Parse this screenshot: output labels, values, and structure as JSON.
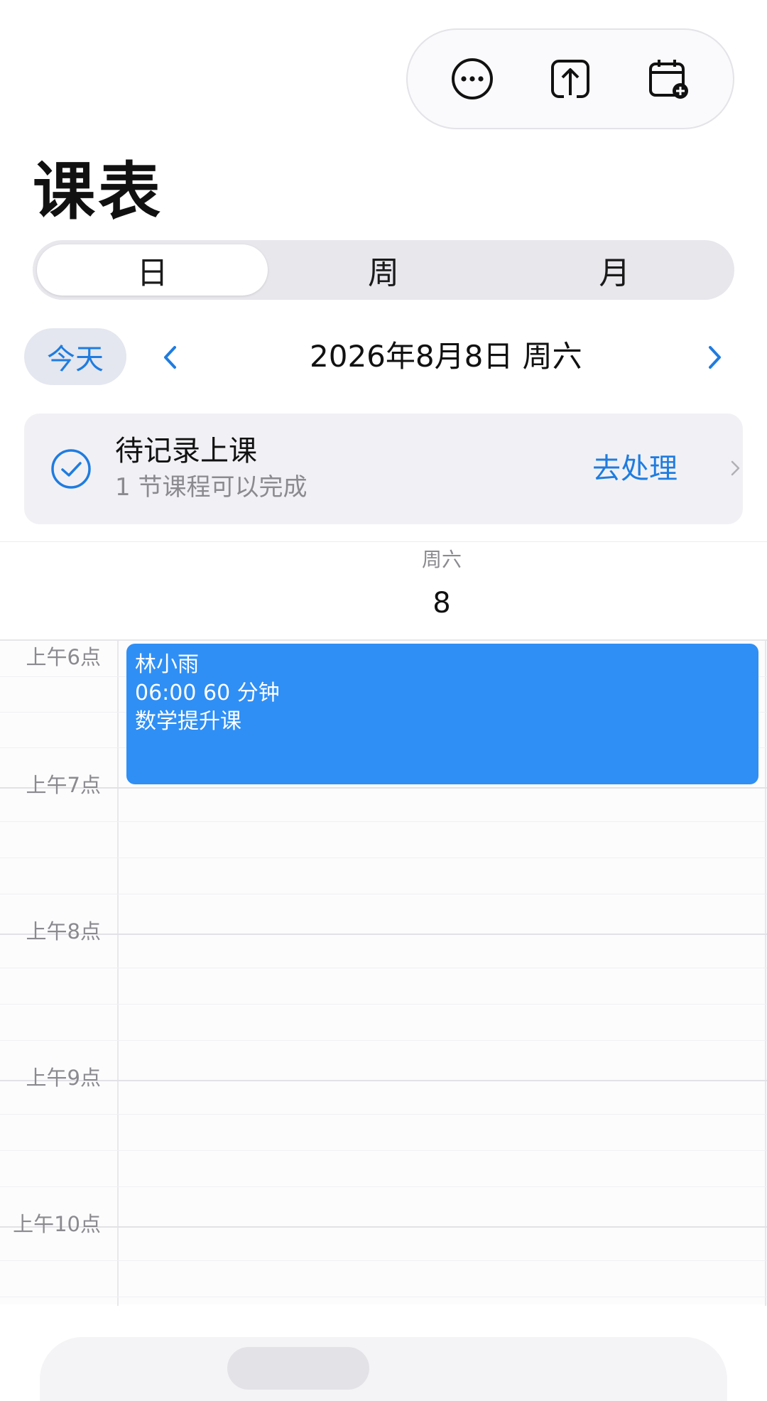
{
  "header": {
    "title": "课表",
    "actions": [
      {
        "name": "more-icon"
      },
      {
        "name": "share-icon"
      },
      {
        "name": "add-calendar-icon"
      }
    ]
  },
  "tabs": [
    {
      "label": "日",
      "active": true
    },
    {
      "label": "周",
      "active": false
    },
    {
      "label": "月",
      "active": false
    }
  ],
  "date_nav": {
    "today_label": "今天",
    "current_date": "2026年8月8日 周六"
  },
  "pending": {
    "title": "待记录上课",
    "subtitle": "1 节课程可以完成",
    "action_label": "去处理"
  },
  "day_header": {
    "weekday": "周六",
    "day": "8"
  },
  "timeline": {
    "hours": [
      "上午6点",
      "上午7点",
      "上午8点",
      "上午9点",
      "上午10点"
    ]
  },
  "events": [
    {
      "student": "林小雨",
      "time": "06:00 60 分钟",
      "course": "数学提升课"
    }
  ],
  "colors": {
    "accent": "#1f7ce0",
    "event": "#2f8ff5"
  }
}
